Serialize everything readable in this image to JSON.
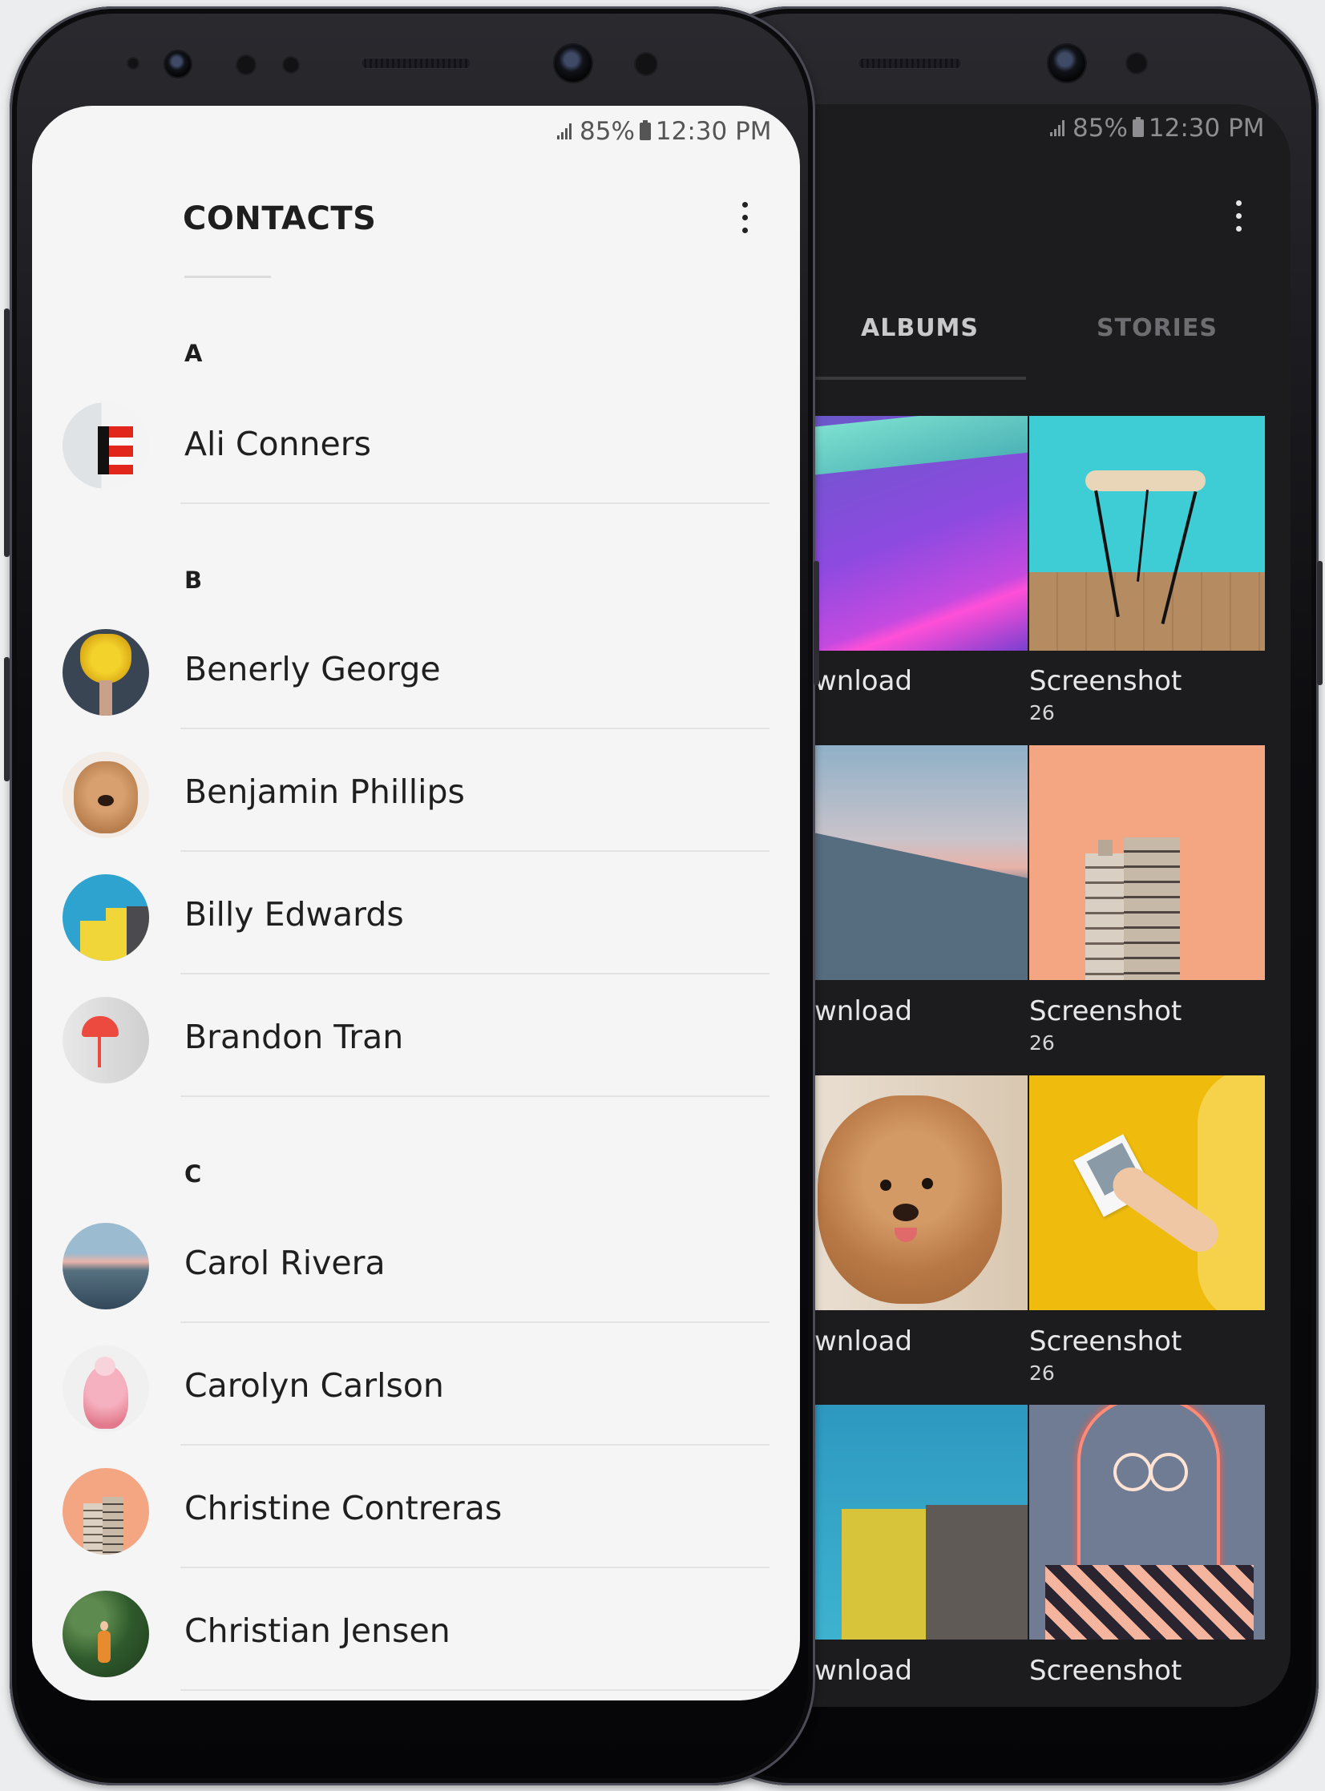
{
  "status_bar": {
    "battery": "85%",
    "time": "12:30 PM"
  },
  "contacts_app": {
    "title": "CONTACTS",
    "menu_icon": "more-vert-icon",
    "sections": [
      {
        "letter": "A",
        "contacts": [
          {
            "name": "Ali Conners",
            "avatar": "lighthouse-photo"
          }
        ]
      },
      {
        "letter": "B",
        "contacts": [
          {
            "name": "Benerly George",
            "avatar": "yellow-flowers-photo"
          },
          {
            "name": "Benjamin Phillips",
            "avatar": "poodle-photo"
          },
          {
            "name": "Billy Edwards",
            "avatar": "yellow-building-photo"
          },
          {
            "name": "Brandon Tran",
            "avatar": "red-lamp-photo"
          }
        ]
      },
      {
        "letter": "C",
        "contacts": [
          {
            "name": "Carol Rivera",
            "avatar": "mountain-photo"
          },
          {
            "name": "Carolyn Carlson",
            "avatar": "cockatoo-photo"
          },
          {
            "name": "Christine Contreras",
            "avatar": "tower-block-photo"
          },
          {
            "name": "Christian Jensen",
            "avatar": "forest-photo"
          }
        ]
      }
    ]
  },
  "gallery_app": {
    "tabs": [
      {
        "label": "ALBUMS",
        "active": true
      },
      {
        "label": "STORIES",
        "active": false
      }
    ],
    "albums": [
      {
        "label": "wnload",
        "count": "",
        "image": "purple-light-room"
      },
      {
        "label": "Screenshot",
        "count": "26",
        "image": "stool-on-wood"
      },
      {
        "label": "wnload",
        "count": "",
        "image": "mountain-valley"
      },
      {
        "label": "Screenshot",
        "count": "26",
        "image": "tower-on-peach"
      },
      {
        "label": "wnload",
        "count": "",
        "image": "poodle"
      },
      {
        "label": "Screenshot",
        "count": "26",
        "image": "polaroid-on-yellow"
      },
      {
        "label": "wnload",
        "count": "",
        "image": "yellow-building-sky"
      },
      {
        "label": "Screenshot",
        "count": "",
        "image": "neon-portrait"
      }
    ]
  },
  "colors": {
    "dark_bg": "#1c1c1e",
    "light_bg": "#f5f5f5",
    "accent_text": "#1e1e1e"
  }
}
